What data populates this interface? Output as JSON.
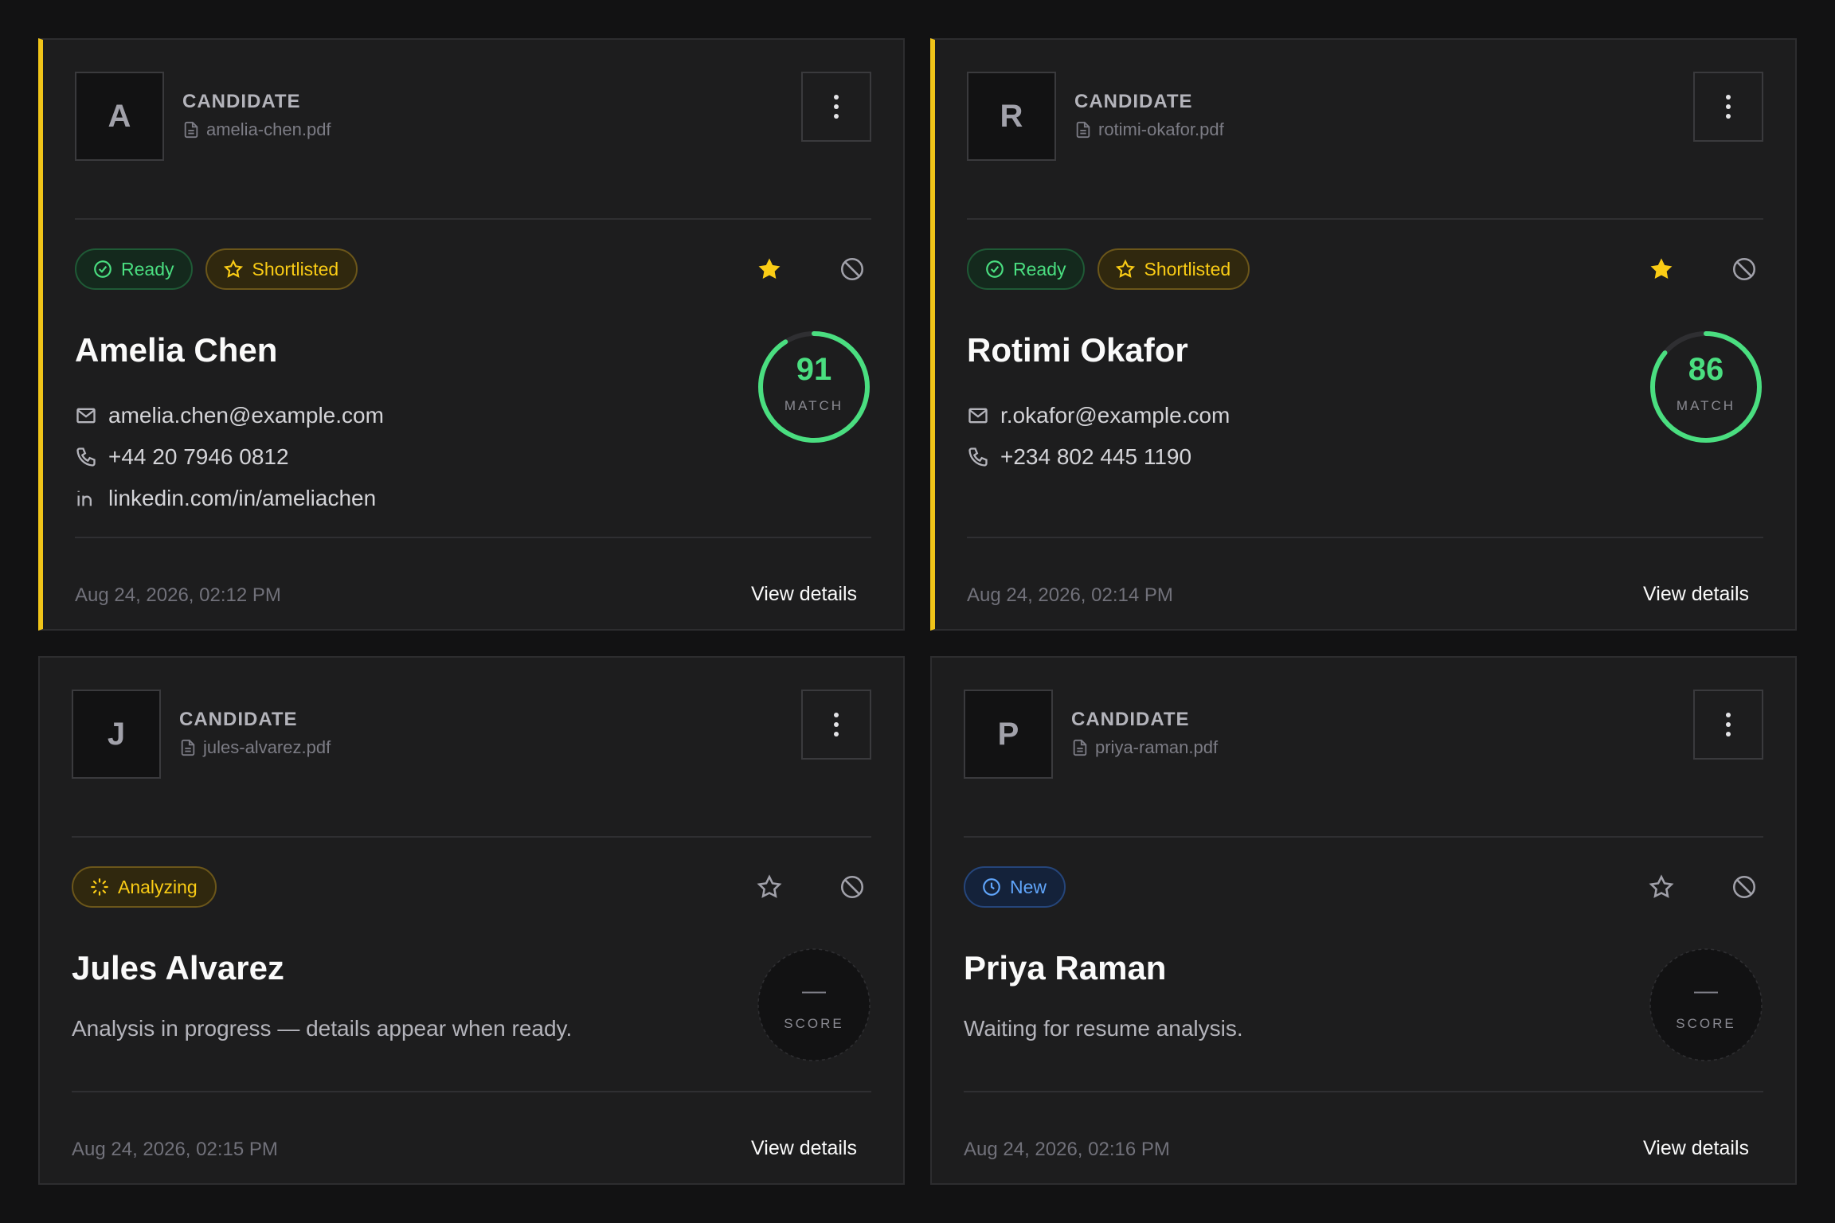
{
  "cards": [
    {
      "initial": "A",
      "kind": "CANDIDATE",
      "file": "amelia-chen.pdf",
      "badges": [
        "Ready",
        "Shortlisted"
      ],
      "starred": true,
      "name": "Amelia Chen",
      "email": "amelia.chen@example.com",
      "phone": "+44 20 7946 0812",
      "linkedin": "linkedin.com/in/ameliachen",
      "score": "91",
      "score_value": 91,
      "score_label": "MATCH",
      "timestamp": "Aug 24, 2026, 02:12 PM",
      "view_label": "View details"
    },
    {
      "initial": "R",
      "kind": "CANDIDATE",
      "file": "rotimi-okafor.pdf",
      "badges": [
        "Ready",
        "Shortlisted"
      ],
      "starred": true,
      "name": "Rotimi Okafor",
      "email": "r.okafor@example.com",
      "phone": "+234 802 445 1190",
      "score": "86",
      "score_value": 86,
      "score_label": "MATCH",
      "timestamp": "Aug 24, 2026, 02:14 PM",
      "view_label": "View details"
    },
    {
      "initial": "J",
      "kind": "CANDIDATE",
      "file": "jules-alvarez.pdf",
      "badges": [
        "Analyzing"
      ],
      "starred": false,
      "name": "Jules Alvarez",
      "note": "Analysis in progress — details appear when ready.",
      "score": "—",
      "score_label": "SCORE",
      "timestamp": "Aug 24, 2026, 02:15 PM",
      "view_label": "View details"
    },
    {
      "initial": "P",
      "kind": "CANDIDATE",
      "file": "priya-raman.pdf",
      "badges": [
        "New"
      ],
      "starred": false,
      "name": "Priya Raman",
      "note": "Waiting for resume analysis.",
      "score": "—",
      "score_label": "SCORE",
      "timestamp": "Aug 24, 2026, 02:16 PM",
      "view_label": "View details"
    }
  ],
  "colors": {
    "accent": "#f0c419",
    "ready": "#4ade80",
    "shortlisted": "#facc15",
    "new": "#60a5fa"
  }
}
